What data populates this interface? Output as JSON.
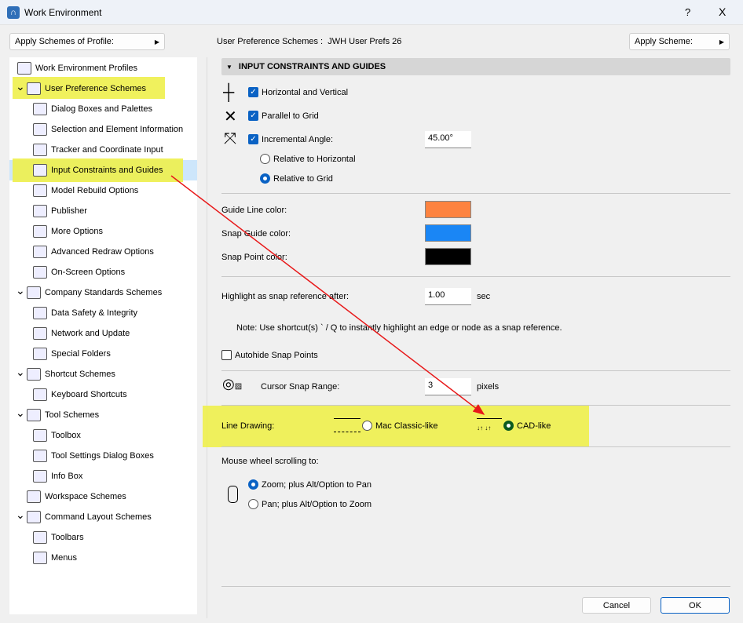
{
  "window": {
    "title": "Work Environment",
    "help": "?",
    "close": "X"
  },
  "top": {
    "apply_profile": "Apply Schemes of Profile:",
    "scheme_label": "User Preference Schemes :",
    "scheme_value": "JWH User Prefs 26",
    "apply_scheme": "Apply Scheme:"
  },
  "tree": [
    {
      "label": "Work Environment Profiles",
      "level": -1,
      "icon": "profiles-icon"
    },
    {
      "label": "User Preference Schemes",
      "level": 0,
      "icon": "user-prefs-icon",
      "expanded": true
    },
    {
      "label": "Dialog Boxes and Palettes",
      "level": 1,
      "icon": "dialog-icon"
    },
    {
      "label": "Selection and Element Information",
      "level": 1,
      "icon": "selection-icon"
    },
    {
      "label": "Tracker and Coordinate Input",
      "level": 1,
      "icon": "xyz-icon"
    },
    {
      "label": "Input Constraints and Guides",
      "level": 1,
      "icon": "cursor-icon",
      "selected": true
    },
    {
      "label": "Model Rebuild Options",
      "level": 1,
      "icon": "rebuild-icon"
    },
    {
      "label": "Publisher",
      "level": 1,
      "icon": "publisher-icon"
    },
    {
      "label": "More Options",
      "level": 1,
      "icon": "sliders-icon"
    },
    {
      "label": "Advanced Redraw Options",
      "level": 1,
      "icon": "redraw-icon"
    },
    {
      "label": "On-Screen Options",
      "level": 1,
      "icon": "monitor-icon"
    },
    {
      "label": "Company Standards Schemes",
      "level": 0,
      "icon": "company-icon",
      "expanded": true
    },
    {
      "label": "Data Safety & Integrity",
      "level": 1,
      "icon": "safety-icon"
    },
    {
      "label": "Network and Update",
      "level": 1,
      "icon": "globe-icon"
    },
    {
      "label": "Special Folders",
      "level": 1,
      "icon": "folder-icon"
    },
    {
      "label": "Shortcut Schemes",
      "level": 0,
      "icon": "shortcut-icon",
      "expanded": true
    },
    {
      "label": "Keyboard Shortcuts",
      "level": 1,
      "icon": "keyboard-icon"
    },
    {
      "label": "Tool Schemes",
      "level": 0,
      "icon": "tool-icon",
      "expanded": true
    },
    {
      "label": "Toolbox",
      "level": 1,
      "icon": "toolbox-icon"
    },
    {
      "label": "Tool Settings Dialog Boxes",
      "level": 1,
      "icon": "tool-settings-icon"
    },
    {
      "label": "Info Box",
      "level": 1,
      "icon": "infobox-icon"
    },
    {
      "label": "Workspace Schemes",
      "level": 0,
      "icon": "workspace-icon",
      "expanded": false
    },
    {
      "label": "Command Layout Schemes",
      "level": 0,
      "icon": "command-icon",
      "expanded": true
    },
    {
      "label": "Toolbars",
      "level": 1,
      "icon": "toolbars-icon"
    },
    {
      "label": "Menus",
      "level": 1,
      "icon": "menus-icon"
    }
  ],
  "panel": {
    "section_title": "INPUT CONSTRAINTS AND GUIDES",
    "horiz_vert": "Horizontal and Vertical",
    "parallel": "Parallel to Grid",
    "incremental": "Incremental Angle:",
    "angle_value": "45.00°",
    "rel_horizontal": "Relative to Horizontal",
    "rel_grid": "Relative to Grid",
    "guide_color_label": "Guide Line color:",
    "guide_color": "#fd8340",
    "snap_guide_label": "Snap Guide color:",
    "snap_guide_color": "#1a86f5",
    "snap_point_label": "Snap Point color:",
    "snap_point_color": "#000000",
    "highlight_label": "Highlight as snap reference after:",
    "highlight_value": "1.00",
    "highlight_unit": "sec",
    "note": "Note: Use shortcut(s) ` / Q to instantly highlight an edge or node as a snap reference.",
    "autohide": "Autohide Snap Points",
    "snap_range_label": "Cursor Snap Range:",
    "snap_range_value": "3",
    "snap_range_unit": "pixels",
    "line_drawing_label": "Line Drawing:",
    "mac_classic": "Mac Classic-like",
    "cad_like": "CAD-like",
    "mouse_wheel_label": "Mouse wheel scrolling to:",
    "zoom_opt": "Zoom; plus Alt/Option to Pan",
    "pan_opt": "Pan; plus Alt/Option to Zoom"
  },
  "footer": {
    "cancel": "Cancel",
    "ok": "OK"
  }
}
